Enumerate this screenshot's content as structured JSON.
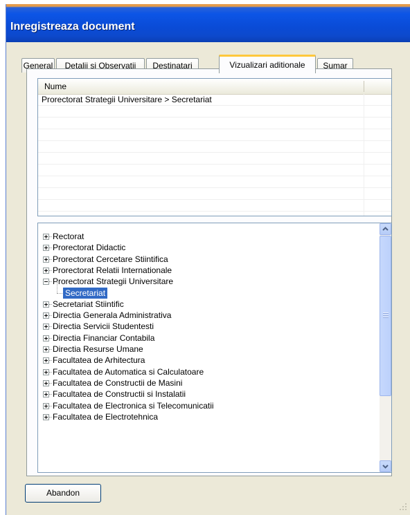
{
  "window": {
    "title": "Inregistreaza document"
  },
  "tabs": [
    {
      "label": "General",
      "active": false
    },
    {
      "label": "Detalii si Observatii",
      "active": false
    },
    {
      "label": "Destinatari",
      "active": false
    },
    {
      "label": "Vizualizari aditionale",
      "active": true
    },
    {
      "label": "Sumar",
      "active": false
    }
  ],
  "grid": {
    "columns": [
      "Nume"
    ],
    "rows": [
      "Prorectorat Strategii Universitare > Secretariat",
      "",
      "",
      "",
      "",
      "",
      "",
      "",
      "",
      ""
    ]
  },
  "tree": {
    "items": [
      {
        "label": "Rectorat",
        "expander": "plus",
        "level": 0
      },
      {
        "label": "Prorectorat Didactic",
        "expander": "plus",
        "level": 0
      },
      {
        "label": "Prorectorat Cercetare Stiintifica",
        "expander": "plus",
        "level": 0
      },
      {
        "label": "Prorectorat Relatii Internationale",
        "expander": "plus",
        "level": 0
      },
      {
        "label": "Prorectorat Strategii Universitare",
        "expander": "minus",
        "level": 0
      },
      {
        "label": "Secretariat",
        "expander": "none",
        "level": 1,
        "selected": true
      },
      {
        "label": "Secretariat Stiintific",
        "expander": "plus",
        "level": 0
      },
      {
        "label": "Directia Generala Administrativa",
        "expander": "plus",
        "level": 0
      },
      {
        "label": "Directia Servicii Studentesti",
        "expander": "plus",
        "level": 0
      },
      {
        "label": "Directia Financiar Contabila",
        "expander": "plus",
        "level": 0
      },
      {
        "label": "Directia Resurse Umane",
        "expander": "plus",
        "level": 0
      },
      {
        "label": "Facultatea de Arhitectura",
        "expander": "plus",
        "level": 0
      },
      {
        "label": "Facultatea de Automatica si Calculatoare",
        "expander": "plus",
        "level": 0
      },
      {
        "label": "Facultatea de Constructii de Masini",
        "expander": "plus",
        "level": 0
      },
      {
        "label": "Facultatea de Constructii si Instalatii",
        "expander": "plus",
        "level": 0
      },
      {
        "label": "Facultatea de Electronica si Telecomunicatii",
        "expander": "plus",
        "level": 0
      },
      {
        "label": "Facultatea de Electrotehnica",
        "expander": "plus",
        "level": 0
      }
    ]
  },
  "footer": {
    "abandon_label": "Abandon"
  },
  "colors": {
    "titlebar": "#0a4bd6",
    "selection": "#316ac5",
    "tab_highlight": "#ffc83c",
    "dialog_bg": "#ece9d8"
  }
}
